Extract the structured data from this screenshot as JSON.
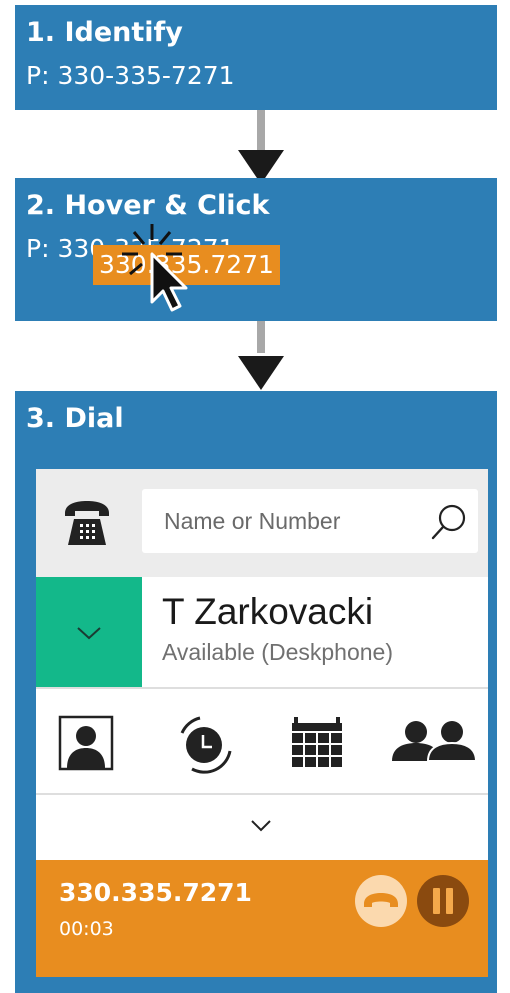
{
  "steps": [
    {
      "title": "1. Identify",
      "subtitle": "P: 330-335-7271"
    },
    {
      "title": "2. Hover & Click",
      "subtitle": "P: 330-335-7271",
      "hover_number": "330.335.7271"
    },
    {
      "title": "3. Dial"
    }
  ],
  "dialer": {
    "search": {
      "placeholder": "Name or Number"
    },
    "user": {
      "name": "T Zarkovacki",
      "status": "Available (Deskphone)"
    },
    "active_call": {
      "number": "330.335.7271",
      "duration": "00:03"
    }
  },
  "colors": {
    "step_background": "#2d7eb5",
    "call_bar": "#e88d1f",
    "user_toggle": "#13b88a",
    "connector": "#a8a8a8"
  },
  "icons": {
    "phone": "desk-phone-icon",
    "search": "search-icon",
    "user_toggle": "chevron-down-icon",
    "nav": [
      "contacts-icon",
      "history-clock-icon",
      "calendar-icon",
      "groups-icon"
    ],
    "expand": "chevron-down-icon",
    "call_actions": [
      "hang-up-icon",
      "pause-icon"
    ],
    "cursor": "mouse-pointer-icon"
  }
}
